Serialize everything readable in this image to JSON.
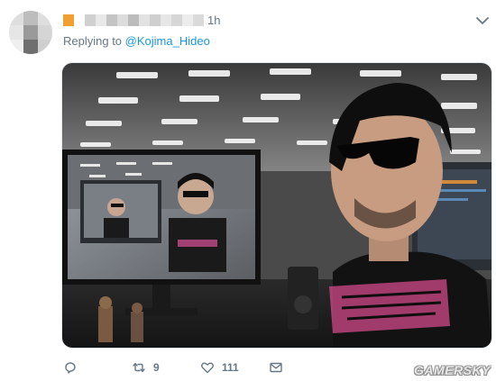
{
  "tweet": {
    "time": "1h",
    "reply_prefix": "Replying to",
    "reply_mention": "@Kojima_Hideo",
    "retweet_count": "9",
    "like_count": "111"
  },
  "watermark": "GAMERSKY",
  "icons": {
    "chevron": "chevron-down-icon",
    "reply": "reply-icon",
    "retweet": "retweet-icon",
    "like": "heart-icon",
    "dm": "mail-icon"
  },
  "colors": {
    "link": "#1b95e0",
    "muted": "#657786",
    "name_block": "#f0a030"
  }
}
